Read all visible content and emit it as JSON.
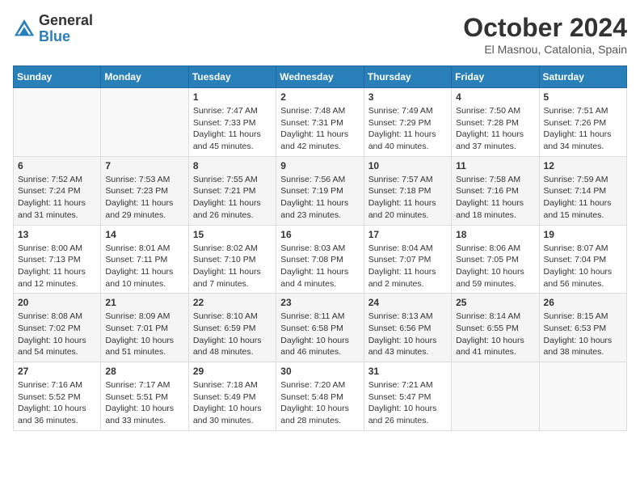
{
  "header": {
    "logo_general": "General",
    "logo_blue": "Blue",
    "month_title": "October 2024",
    "location": "El Masnou, Catalonia, Spain"
  },
  "weekdays": [
    "Sunday",
    "Monday",
    "Tuesday",
    "Wednesday",
    "Thursday",
    "Friday",
    "Saturday"
  ],
  "weeks": [
    [
      {
        "day": "",
        "sunrise": "",
        "sunset": "",
        "daylight": ""
      },
      {
        "day": "",
        "sunrise": "",
        "sunset": "",
        "daylight": ""
      },
      {
        "day": "1",
        "sunrise": "Sunrise: 7:47 AM",
        "sunset": "Sunset: 7:33 PM",
        "daylight": "Daylight: 11 hours and 45 minutes."
      },
      {
        "day": "2",
        "sunrise": "Sunrise: 7:48 AM",
        "sunset": "Sunset: 7:31 PM",
        "daylight": "Daylight: 11 hours and 42 minutes."
      },
      {
        "day": "3",
        "sunrise": "Sunrise: 7:49 AM",
        "sunset": "Sunset: 7:29 PM",
        "daylight": "Daylight: 11 hours and 40 minutes."
      },
      {
        "day": "4",
        "sunrise": "Sunrise: 7:50 AM",
        "sunset": "Sunset: 7:28 PM",
        "daylight": "Daylight: 11 hours and 37 minutes."
      },
      {
        "day": "5",
        "sunrise": "Sunrise: 7:51 AM",
        "sunset": "Sunset: 7:26 PM",
        "daylight": "Daylight: 11 hours and 34 minutes."
      }
    ],
    [
      {
        "day": "6",
        "sunrise": "Sunrise: 7:52 AM",
        "sunset": "Sunset: 7:24 PM",
        "daylight": "Daylight: 11 hours and 31 minutes."
      },
      {
        "day": "7",
        "sunrise": "Sunrise: 7:53 AM",
        "sunset": "Sunset: 7:23 PM",
        "daylight": "Daylight: 11 hours and 29 minutes."
      },
      {
        "day": "8",
        "sunrise": "Sunrise: 7:55 AM",
        "sunset": "Sunset: 7:21 PM",
        "daylight": "Daylight: 11 hours and 26 minutes."
      },
      {
        "day": "9",
        "sunrise": "Sunrise: 7:56 AM",
        "sunset": "Sunset: 7:19 PM",
        "daylight": "Daylight: 11 hours and 23 minutes."
      },
      {
        "day": "10",
        "sunrise": "Sunrise: 7:57 AM",
        "sunset": "Sunset: 7:18 PM",
        "daylight": "Daylight: 11 hours and 20 minutes."
      },
      {
        "day": "11",
        "sunrise": "Sunrise: 7:58 AM",
        "sunset": "Sunset: 7:16 PM",
        "daylight": "Daylight: 11 hours and 18 minutes."
      },
      {
        "day": "12",
        "sunrise": "Sunrise: 7:59 AM",
        "sunset": "Sunset: 7:14 PM",
        "daylight": "Daylight: 11 hours and 15 minutes."
      }
    ],
    [
      {
        "day": "13",
        "sunrise": "Sunrise: 8:00 AM",
        "sunset": "Sunset: 7:13 PM",
        "daylight": "Daylight: 11 hours and 12 minutes."
      },
      {
        "day": "14",
        "sunrise": "Sunrise: 8:01 AM",
        "sunset": "Sunset: 7:11 PM",
        "daylight": "Daylight: 11 hours and 10 minutes."
      },
      {
        "day": "15",
        "sunrise": "Sunrise: 8:02 AM",
        "sunset": "Sunset: 7:10 PM",
        "daylight": "Daylight: 11 hours and 7 minutes."
      },
      {
        "day": "16",
        "sunrise": "Sunrise: 8:03 AM",
        "sunset": "Sunset: 7:08 PM",
        "daylight": "Daylight: 11 hours and 4 minutes."
      },
      {
        "day": "17",
        "sunrise": "Sunrise: 8:04 AM",
        "sunset": "Sunset: 7:07 PM",
        "daylight": "Daylight: 11 hours and 2 minutes."
      },
      {
        "day": "18",
        "sunrise": "Sunrise: 8:06 AM",
        "sunset": "Sunset: 7:05 PM",
        "daylight": "Daylight: 10 hours and 59 minutes."
      },
      {
        "day": "19",
        "sunrise": "Sunrise: 8:07 AM",
        "sunset": "Sunset: 7:04 PM",
        "daylight": "Daylight: 10 hours and 56 minutes."
      }
    ],
    [
      {
        "day": "20",
        "sunrise": "Sunrise: 8:08 AM",
        "sunset": "Sunset: 7:02 PM",
        "daylight": "Daylight: 10 hours and 54 minutes."
      },
      {
        "day": "21",
        "sunrise": "Sunrise: 8:09 AM",
        "sunset": "Sunset: 7:01 PM",
        "daylight": "Daylight: 10 hours and 51 minutes."
      },
      {
        "day": "22",
        "sunrise": "Sunrise: 8:10 AM",
        "sunset": "Sunset: 6:59 PM",
        "daylight": "Daylight: 10 hours and 48 minutes."
      },
      {
        "day": "23",
        "sunrise": "Sunrise: 8:11 AM",
        "sunset": "Sunset: 6:58 PM",
        "daylight": "Daylight: 10 hours and 46 minutes."
      },
      {
        "day": "24",
        "sunrise": "Sunrise: 8:13 AM",
        "sunset": "Sunset: 6:56 PM",
        "daylight": "Daylight: 10 hours and 43 minutes."
      },
      {
        "day": "25",
        "sunrise": "Sunrise: 8:14 AM",
        "sunset": "Sunset: 6:55 PM",
        "daylight": "Daylight: 10 hours and 41 minutes."
      },
      {
        "day": "26",
        "sunrise": "Sunrise: 8:15 AM",
        "sunset": "Sunset: 6:53 PM",
        "daylight": "Daylight: 10 hours and 38 minutes."
      }
    ],
    [
      {
        "day": "27",
        "sunrise": "Sunrise: 7:16 AM",
        "sunset": "Sunset: 5:52 PM",
        "daylight": "Daylight: 10 hours and 36 minutes."
      },
      {
        "day": "28",
        "sunrise": "Sunrise: 7:17 AM",
        "sunset": "Sunset: 5:51 PM",
        "daylight": "Daylight: 10 hours and 33 minutes."
      },
      {
        "day": "29",
        "sunrise": "Sunrise: 7:18 AM",
        "sunset": "Sunset: 5:49 PM",
        "daylight": "Daylight: 10 hours and 30 minutes."
      },
      {
        "day": "30",
        "sunrise": "Sunrise: 7:20 AM",
        "sunset": "Sunset: 5:48 PM",
        "daylight": "Daylight: 10 hours and 28 minutes."
      },
      {
        "day": "31",
        "sunrise": "Sunrise: 7:21 AM",
        "sunset": "Sunset: 5:47 PM",
        "daylight": "Daylight: 10 hours and 26 minutes."
      },
      {
        "day": "",
        "sunrise": "",
        "sunset": "",
        "daylight": ""
      },
      {
        "day": "",
        "sunrise": "",
        "sunset": "",
        "daylight": ""
      }
    ]
  ]
}
